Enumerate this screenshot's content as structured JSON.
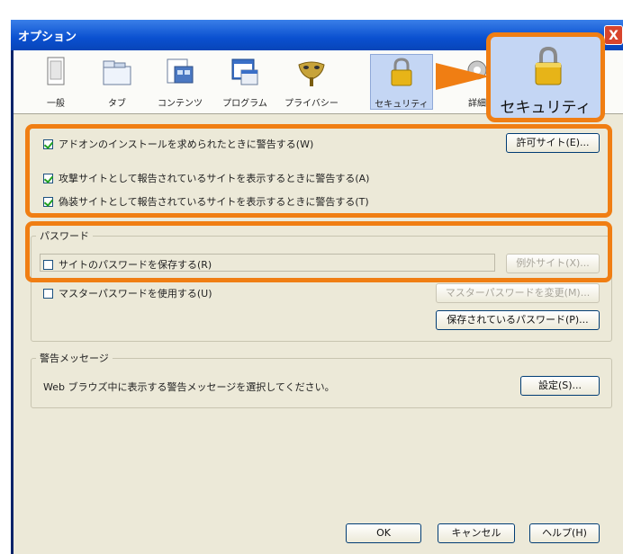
{
  "window": {
    "title": "オプション",
    "close_glyph": "X"
  },
  "toolbar": {
    "items": [
      {
        "label": "一般",
        "icon": "window-icon"
      },
      {
        "label": "タブ",
        "icon": "tabs-icon"
      },
      {
        "label": "コンテンツ",
        "icon": "content-icon"
      },
      {
        "label": "プログラム",
        "icon": "programs-icon"
      },
      {
        "label": "プライバシー",
        "icon": "privacy-mask-icon"
      },
      {
        "label": "セキュリティ",
        "icon": "padlock-icon",
        "selected": true
      },
      {
        "label": "詳細",
        "icon": "gear-icon"
      }
    ]
  },
  "callout": {
    "label": "セキュリティ",
    "icon": "padlock-icon"
  },
  "security": {
    "warn_addon": {
      "label": "アドオンのインストールを求められたときに警告する(W)",
      "checked": true
    },
    "exceptions_button": "許可サイト(E)...",
    "attack_site": {
      "label": "攻撃サイトとして報告されているサイトを表示するときに警告する(A)",
      "checked": true
    },
    "forgery_site": {
      "label": "偽装サイトとして報告されているサイトを表示するときに警告する(T)",
      "checked": true
    }
  },
  "passwords": {
    "legend": "パスワード",
    "remember": {
      "label": "サイトのパスワードを保存する(R)",
      "checked": false
    },
    "exceptions_button": "例外サイト(X)...",
    "master": {
      "label": "マスターパスワードを使用する(U)",
      "checked": false
    },
    "change_master_button": "マスターパスワードを変更(M)...",
    "saved_button": "保存されているパスワード(P)..."
  },
  "warnings": {
    "legend": "警告メッセージ",
    "description": "Web ブラウズ中に表示する警告メッセージを選択してください。",
    "settings_button": "設定(S)..."
  },
  "footer": {
    "ok": "OK",
    "cancel": "キャンセル",
    "help": "ヘルプ(H)"
  },
  "colors": {
    "highlight": "#f07e13",
    "title_bar": "#0a50d0",
    "dialog_bg": "#ece9d8",
    "selected_tab": "#c4d6f4"
  }
}
